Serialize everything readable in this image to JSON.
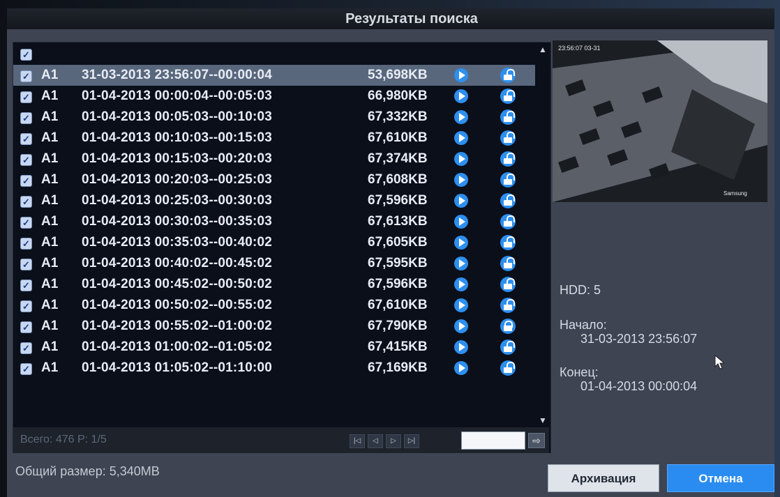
{
  "window": {
    "title": "Результаты поиска"
  },
  "list": {
    "select_all_checked": true,
    "rows": [
      {
        "camera": "A1",
        "time_range": "31-03-2013 23:56:07--00:00:04",
        "size": "53,698KB",
        "locked": false,
        "checked": true,
        "selected": true
      },
      {
        "camera": "A1",
        "time_range": "01-04-2013 00:00:04--00:05:03",
        "size": "66,980KB",
        "locked": false,
        "checked": true
      },
      {
        "camera": "A1",
        "time_range": "01-04-2013 00:05:03--00:10:03",
        "size": "67,332KB",
        "locked": false,
        "checked": true
      },
      {
        "camera": "A1",
        "time_range": "01-04-2013 00:10:03--00:15:03",
        "size": "67,610KB",
        "locked": false,
        "checked": true
      },
      {
        "camera": "A1",
        "time_range": "01-04-2013 00:15:03--00:20:03",
        "size": "67,374KB",
        "locked": false,
        "checked": true
      },
      {
        "camera": "A1",
        "time_range": "01-04-2013 00:20:03--00:25:03",
        "size": "67,608KB",
        "locked": false,
        "checked": true
      },
      {
        "camera": "A1",
        "time_range": "01-04-2013 00:25:03--00:30:03",
        "size": "67,596KB",
        "locked": false,
        "checked": true
      },
      {
        "camera": "A1",
        "time_range": "01-04-2013 00:30:03--00:35:03",
        "size": "67,613KB",
        "locked": false,
        "checked": true
      },
      {
        "camera": "A1",
        "time_range": "01-04-2013 00:35:03--00:40:02",
        "size": "67,605KB",
        "locked": false,
        "checked": true
      },
      {
        "camera": "A1",
        "time_range": "01-04-2013 00:40:02--00:45:02",
        "size": "67,595KB",
        "locked": false,
        "checked": true
      },
      {
        "camera": "A1",
        "time_range": "01-04-2013 00:45:02--00:50:02",
        "size": "67,596KB",
        "locked": false,
        "checked": true
      },
      {
        "camera": "A1",
        "time_range": "01-04-2013 00:50:02--00:55:02",
        "size": "67,610KB",
        "locked": false,
        "checked": true
      },
      {
        "camera": "A1",
        "time_range": "01-04-2013 00:55:02--01:00:02",
        "size": "67,790KB",
        "locked": true,
        "checked": true
      },
      {
        "camera": "A1",
        "time_range": "01-04-2013 01:00:02--01:05:02",
        "size": "67,415KB",
        "locked": false,
        "checked": true
      },
      {
        "camera": "A1",
        "time_range": "01-04-2013 01:05:02--01:10:00",
        "size": "67,169KB",
        "locked": false,
        "checked": true
      }
    ]
  },
  "pager": {
    "total_label": "Всего: 476 P: 1/5",
    "page_input_value": "",
    "first_symbol": "|◁",
    "prev_symbol": "◁",
    "next_symbol": "▷",
    "last_symbol": "▷|",
    "go_symbol": "⇨"
  },
  "preview": {
    "timestamp_overlay": "23:56:07 03-31",
    "corner_label": "Samsung"
  },
  "info": {
    "hdd": "HDD: 5",
    "start_label": "Начало:",
    "start_value": "31-03-2013 23:56:07",
    "end_label": "Конец:",
    "end_value": "01-04-2013 00:00:04"
  },
  "footer": {
    "total_size": "Общий размер: 5,340MB",
    "archive_label": "Архивация",
    "cancel_label": "Отмена"
  },
  "colors": {
    "accent": "#2a8cf0",
    "selected_row": "#59677d",
    "list_background": "#0a0f1a",
    "window_background": "#3e4452"
  },
  "icons": {
    "row_check": "checkbox-checked-icon",
    "play": "play-icon",
    "lock_open": "unlocked-icon",
    "lock_closed": "locked-icon"
  }
}
